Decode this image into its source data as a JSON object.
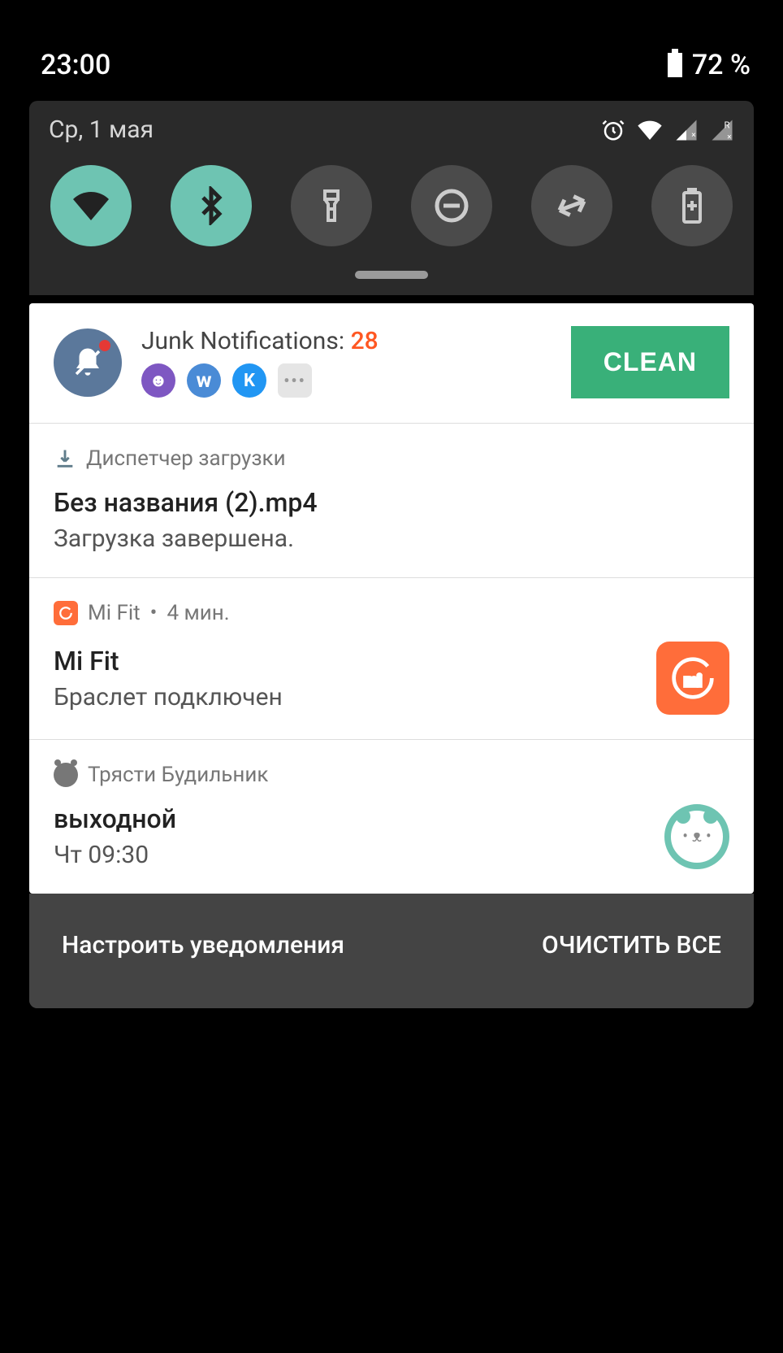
{
  "status": {
    "time": "23:00",
    "battery_pct": "72 %"
  },
  "qs": {
    "date": "Ср, 1 мая",
    "tiles": {
      "wifi": "wifi",
      "bluetooth": "bluetooth",
      "flashlight": "flashlight",
      "dnd": "dnd",
      "rotate": "rotate",
      "battery": "battery"
    }
  },
  "junk": {
    "title_prefix": "Junk Notifications: ",
    "count": "28",
    "clean_label": "CLEAN"
  },
  "download": {
    "app": "Диспетчер загрузки",
    "file": "Без названия (2).mp4",
    "status": "Загрузка завершена."
  },
  "mifit": {
    "app": "Mi Fit",
    "time": "4 мин.",
    "title": "Mi Fit",
    "body": "Браслет подключен"
  },
  "alarm": {
    "app": "Трясти Будильник",
    "title": "выходной",
    "time": "Чт 09:30"
  },
  "footer": {
    "manage": "Настроить уведомления",
    "clear_all": "ОЧИСТИТЬ ВСЕ"
  }
}
